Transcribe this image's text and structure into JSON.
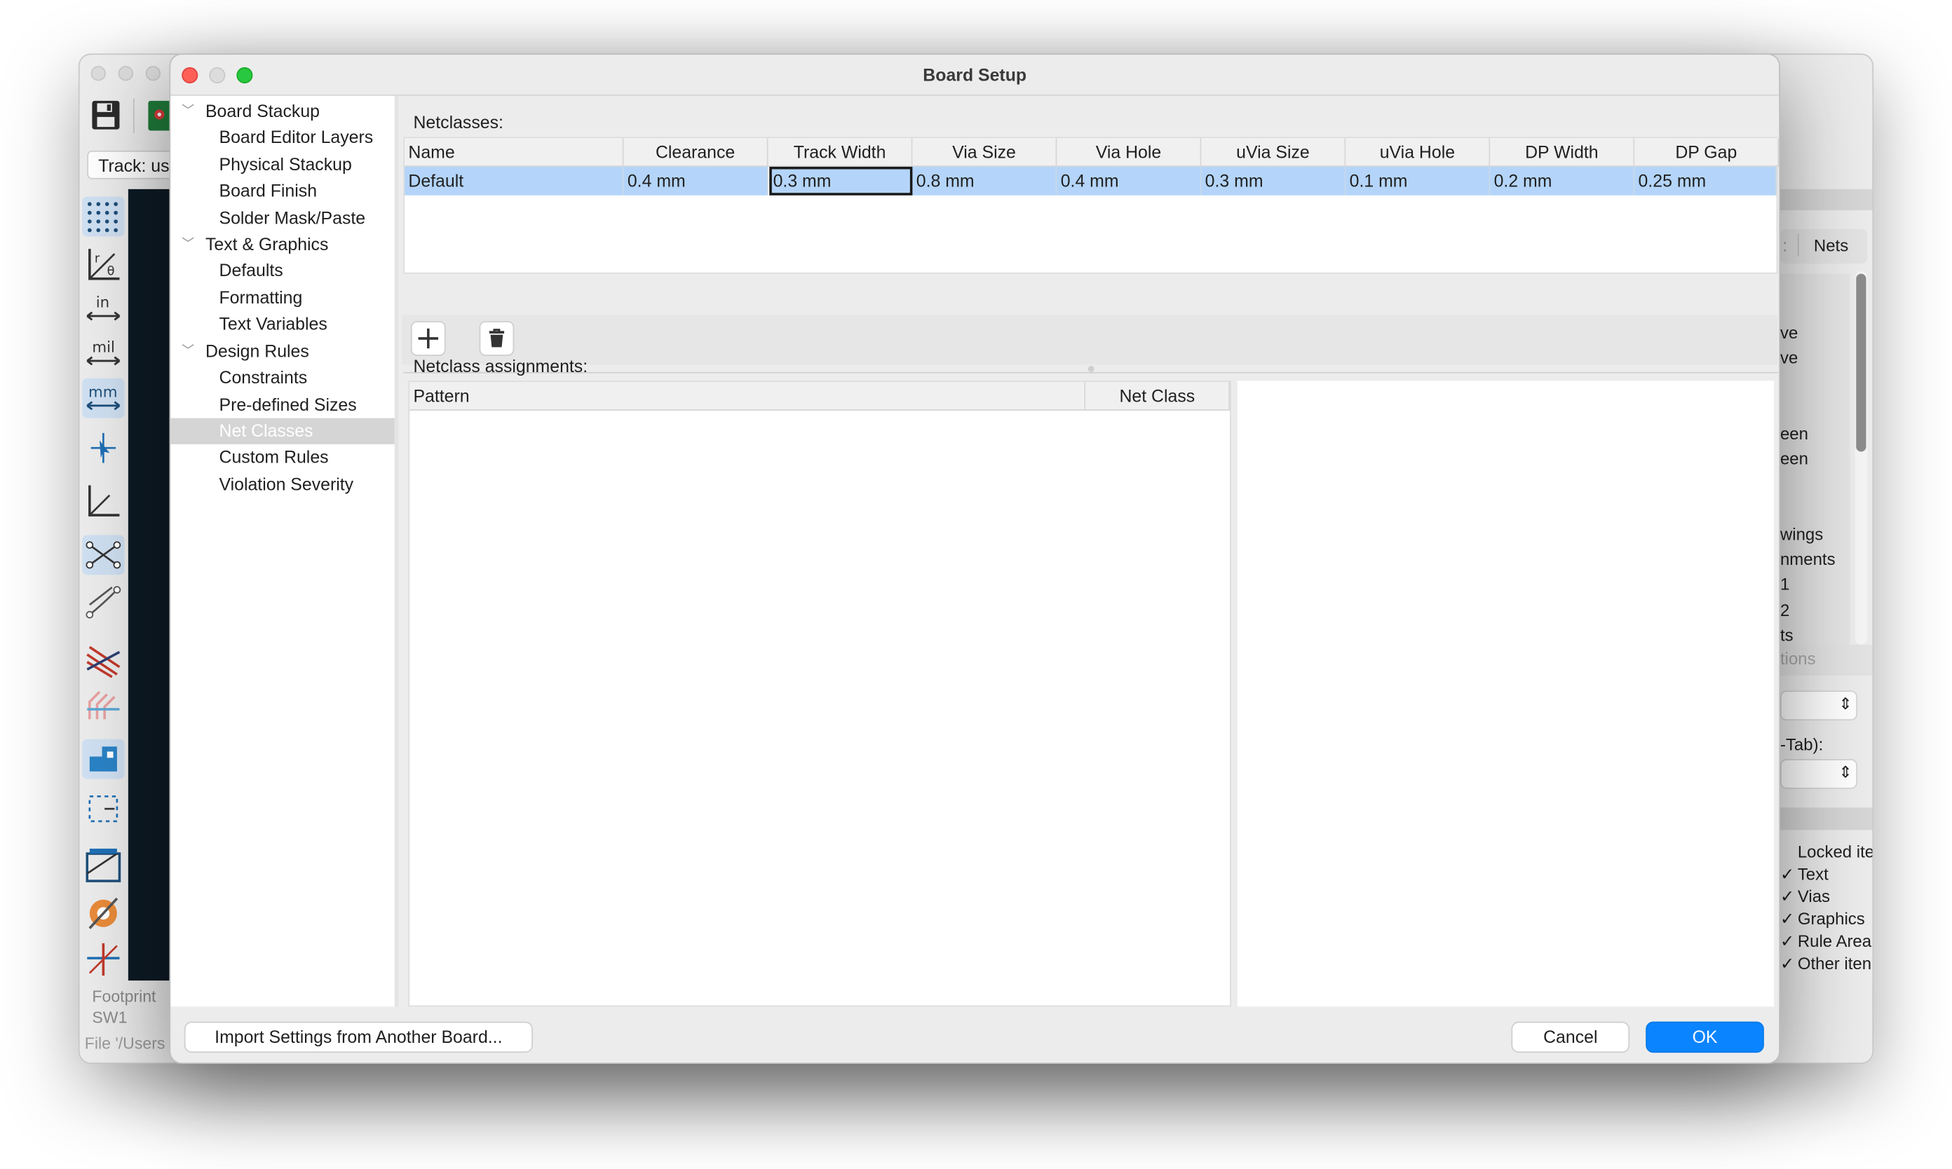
{
  "background_window": {
    "track_field": "Track: us",
    "footprint_label": "Footprint",
    "footprint_ref": "SW1",
    "file_status": "File '/Users",
    "right_panel": {
      "tab_nets": "Nets",
      "tab_partial": ":",
      "list_items": [
        "ve",
        "ve",
        "een",
        "een",
        "wings",
        "nments",
        "1",
        "2",
        "ts"
      ],
      "options_partial": "tions",
      "tab_hint": "-Tab):",
      "checkbox_items": [
        "Locked ite",
        "Text",
        "Vias",
        "Graphics",
        "Rule Area",
        "Other iten"
      ]
    },
    "toolbar_icons": [
      "save-icon",
      "pcb-icon"
    ],
    "left_tools": [
      "grid-icon",
      "polar-coords-icon",
      "inch-units-icon",
      "mil-units-icon",
      "mm-units-icon",
      "cursor-icon",
      "axis-icon",
      "ratsnest-icon",
      "curved-ratsnest-icon",
      "net-highlight-icon",
      "track-icon",
      "pad-icon",
      "selection-icon",
      "board-icon",
      "via-icon",
      "crosshair-icon"
    ]
  },
  "dialog": {
    "title": "Board Setup",
    "tree": [
      {
        "label": "Board Stackup",
        "level": 0,
        "expanded": true
      },
      {
        "label": "Board Editor Layers",
        "level": 1
      },
      {
        "label": "Physical Stackup",
        "level": 1
      },
      {
        "label": "Board Finish",
        "level": 1
      },
      {
        "label": "Solder Mask/Paste",
        "level": 1
      },
      {
        "label": "Text & Graphics",
        "level": 0,
        "expanded": true
      },
      {
        "label": "Defaults",
        "level": 1
      },
      {
        "label": "Formatting",
        "level": 1
      },
      {
        "label": "Text Variables",
        "level": 1
      },
      {
        "label": "Design Rules",
        "level": 0,
        "expanded": true
      },
      {
        "label": "Constraints",
        "level": 1
      },
      {
        "label": "Pre-defined Sizes",
        "level": 1
      },
      {
        "label": "Net Classes",
        "level": 1,
        "selected": true
      },
      {
        "label": "Custom Rules",
        "level": 1
      },
      {
        "label": "Violation Severity",
        "level": 1
      }
    ],
    "netclasses": {
      "label": "Netclasses:",
      "columns": [
        "Name",
        "Clearance",
        "Track Width",
        "Via Size",
        "Via Hole",
        "uVia Size",
        "uVia Hole",
        "DP Width",
        "DP Gap"
      ],
      "rows": [
        [
          "Default",
          "0.4 mm",
          "0.3 mm",
          "0.8 mm",
          "0.4 mm",
          "0.3 mm",
          "0.1 mm",
          "0.2 mm",
          "0.25 mm"
        ]
      ],
      "add_icon": "plus-icon",
      "delete_icon": "trash-icon"
    },
    "assignments": {
      "label": "Netclass assignments:",
      "columns": [
        "Pattern",
        "Net Class"
      ]
    },
    "buttons": {
      "import": "Import Settings from Another Board...",
      "cancel": "Cancel",
      "ok": "OK"
    },
    "colors": {
      "accent": "#0a84ff",
      "selection": "#b4d5f9",
      "close": "#fe5f57",
      "zoom": "#28c840"
    }
  }
}
